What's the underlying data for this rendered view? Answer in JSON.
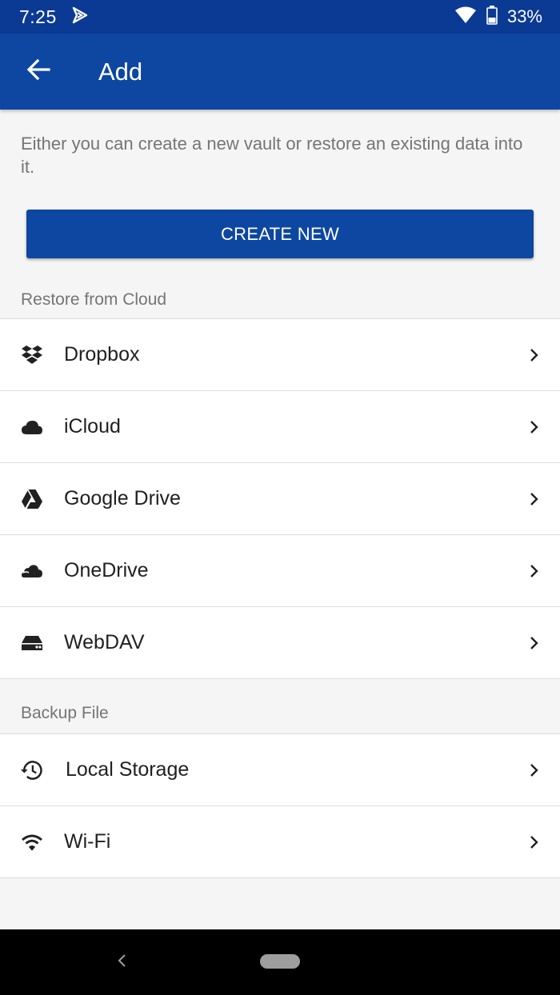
{
  "status_bar": {
    "time": "7:25",
    "battery_percent": "33%",
    "icons": [
      "notification-icon",
      "wifi-icon",
      "battery-icon"
    ]
  },
  "app_bar": {
    "title": "Add",
    "back_icon": "arrow-back-icon"
  },
  "intro": {
    "description": "Either you can create a new vault or restore an existing data into it.",
    "create_button": "CREATE NEW"
  },
  "cloud_section": {
    "header": "Restore from Cloud",
    "items": [
      {
        "label": "Dropbox",
        "icon": "dropbox-icon"
      },
      {
        "label": "iCloud",
        "icon": "cloud-icon"
      },
      {
        "label": "Google Drive",
        "icon": "google-drive-icon"
      },
      {
        "label": "OneDrive",
        "icon": "onedrive-icon"
      },
      {
        "label": "WebDAV",
        "icon": "server-drive-icon"
      }
    ]
  },
  "backup_section": {
    "header": "Backup File",
    "items": [
      {
        "label": "Local Storage",
        "icon": "history-icon"
      },
      {
        "label": "Wi-Fi",
        "icon": "wifi-icon"
      }
    ]
  },
  "colors": {
    "status_bar": "#0b3a94",
    "app_bar": "#0d47a1",
    "primary_button": "#0d47a1",
    "background": "#f5f5f5",
    "secondary_text": "#757575"
  }
}
